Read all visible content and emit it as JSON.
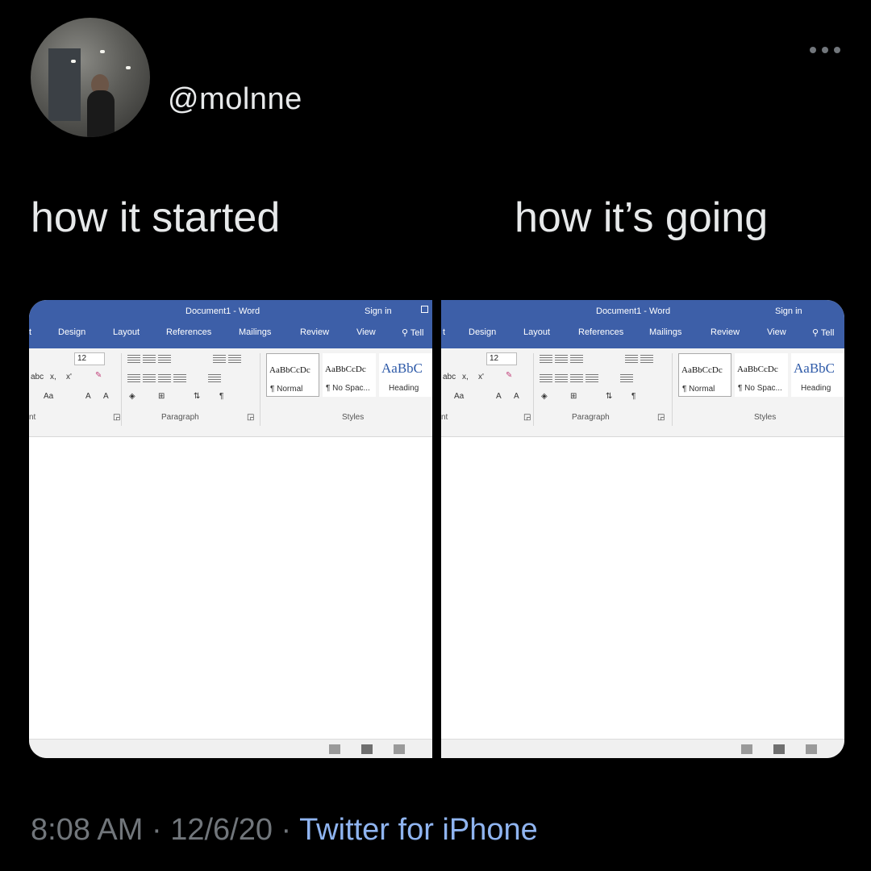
{
  "tweet": {
    "handle": "@molnne",
    "more_icon": "ellipsis-icon",
    "caption_left": "how it started",
    "caption_right": "how it’s going",
    "timestamp": "8:08 AM · 12/6/20 · ",
    "source": "Twitter for iPhone"
  },
  "word_left": {
    "title": "Document1 - Word",
    "signin": "Sign in",
    "tabs": [
      "t",
      "Design",
      "Layout",
      "References",
      "Mailings",
      "Review",
      "View",
      "Tell"
    ],
    "font_size": "12",
    "ribbon_texts": [
      "abc",
      "x,",
      "x'",
      "Aa",
      "A",
      "A",
      "¶"
    ],
    "group_font": "nt",
    "group_paragraph": "Paragraph",
    "group_styles": "Styles",
    "styles": [
      {
        "sample": "AaBbCcDc",
        "name": "¶ Normal"
      },
      {
        "sample": "AaBbCcDc",
        "name": "¶ No Spac..."
      },
      {
        "sample": "AaBbC",
        "name": "Heading"
      }
    ]
  },
  "word_right": {
    "title": "Document1 - Word",
    "signin": "Sign in",
    "tabs": [
      "t",
      "Design",
      "Layout",
      "References",
      "Mailings",
      "Review",
      "View",
      "Tell"
    ],
    "font_size": "12",
    "ribbon_texts": [
      "abc",
      "x,",
      "x'",
      "Aa",
      "A",
      "A",
      "¶"
    ],
    "group_font": "nt",
    "group_paragraph": "Paragraph",
    "group_styles": "Styles",
    "styles": [
      {
        "sample": "AaBbCcDc",
        "name": "¶ Normal"
      },
      {
        "sample": "AaBbCcDc",
        "name": "¶ No Spac..."
      },
      {
        "sample": "AaBbC",
        "name": "Heading"
      }
    ]
  }
}
